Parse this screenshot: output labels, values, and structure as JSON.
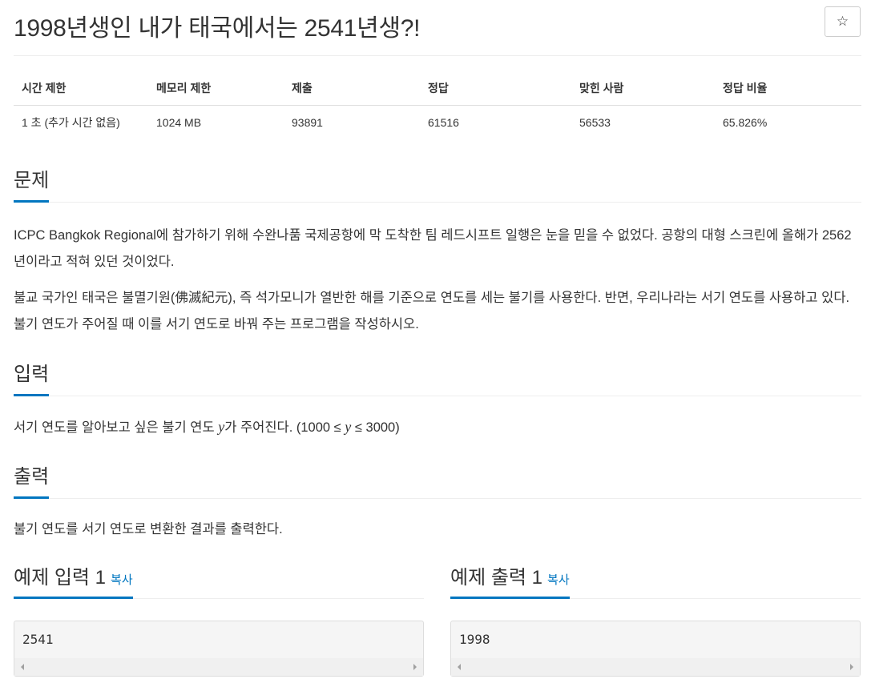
{
  "problem": {
    "title": "1998년생인 내가 태국에서는 2541년생?!",
    "star_icon": "☆"
  },
  "info_table": {
    "headers": [
      "시간 제한",
      "메모리 제한",
      "제출",
      "정답",
      "맞힌 사람",
      "정답 비율"
    ],
    "values": [
      "1 초 (추가 시간 없음)",
      "1024 MB",
      "93891",
      "61516",
      "56533",
      "65.826%"
    ]
  },
  "sections": {
    "description": {
      "title": "문제",
      "paragraphs": [
        "ICPC Bangkok Regional에 참가하기 위해 수완나품 국제공항에 막 도착한 팀 레드시프트 일행은 눈을 믿을 수 없었다. 공항의 대형 스크린에 올해가 2562년이라고 적혀 있던 것이었다.",
        "불교 국가인 태국은 불멸기원(佛滅紀元), 즉 석가모니가 열반한 해를 기준으로 연도를 세는 불기를 사용한다. 반면, 우리나라는 서기 연도를 사용하고 있다. 불기 연도가 주어질 때 이를 서기 연도로 바꿔 주는 프로그램을 작성하시오."
      ]
    },
    "input": {
      "title": "입력",
      "text_before": "서기 연도를 알아보고 싶은 불기 연도 ",
      "var": "y",
      "text_mid": "가 주어진다. (1000 ≤ ",
      "var2": "y",
      "text_after": " ≤ 3000)"
    },
    "output": {
      "title": "출력",
      "text": "불기 연도를 서기 연도로 변환한 결과를 출력한다."
    }
  },
  "samples": {
    "input": {
      "title": "예제 입력 1",
      "copy_label": "복사",
      "content": "2541"
    },
    "output": {
      "title": "예제 출력 1",
      "copy_label": "복사",
      "content": "1998"
    }
  },
  "colors": {
    "accent": "#0076c0",
    "text": "#333333",
    "sample_bg": "#f5f5f5"
  }
}
